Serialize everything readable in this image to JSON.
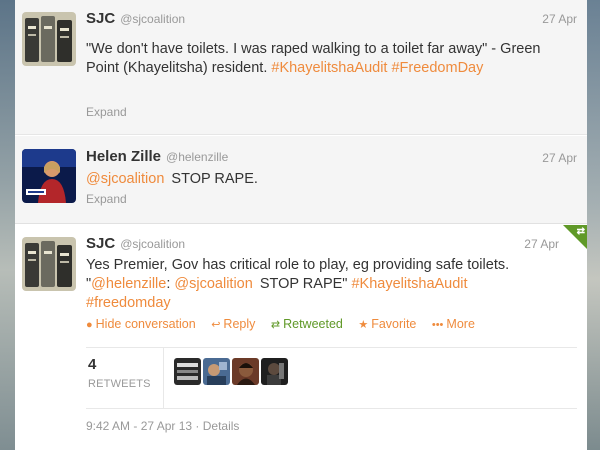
{
  "tweets": [
    {
      "name": "SJC",
      "handle": "@sjcoalition",
      "date": "27 Apr",
      "text_plain": "\"We don't have toilets. I was raped walking to a toilet far away\" - Green Point (Khayelitsha) resident.",
      "hashtag1": "#KhayelitshaAudit",
      "hashtag2": "#FreedomDay",
      "expand": "Expand"
    },
    {
      "name": "Helen Zille",
      "handle": "@helenzille",
      "date": "27 Apr",
      "mention": "@sjcoalition",
      "text_plain": "STOP RAPE.",
      "expand": "Expand"
    },
    {
      "name": "SJC",
      "handle": "@sjcoalition",
      "date": "27 Apr",
      "line1": "Yes Premier, Gov has critical role to play, eg providing safe toilets.",
      "quote_open": "\"",
      "mention1": "@helenzille",
      "colon": ":",
      "mention2": "@sjcoalition",
      "quote_text": "STOP RAPE\"",
      "hashtag1": "#KhayelitshaAudit",
      "hashtag2": "#freedomday",
      "actions": {
        "hide": "Hide conversation",
        "reply": "Reply",
        "retweeted": "Retweeted",
        "favorite": "Favorite",
        "more": "More"
      },
      "retweet_count": "4",
      "retweet_label": "RETWEETS",
      "timestamp": "9:42 AM - 27 Apr 13 · Details"
    }
  ],
  "colors": {
    "link": "#ef8b3d",
    "retweeted": "#609928",
    "muted": "#999999"
  },
  "icons": {
    "hide": "speech-bubble-icon",
    "reply": "reply-arrow-icon",
    "retweet": "retweet-icon",
    "favorite": "star-icon",
    "more": "ellipsis-icon",
    "corner": "retweeted-corner-icon"
  }
}
